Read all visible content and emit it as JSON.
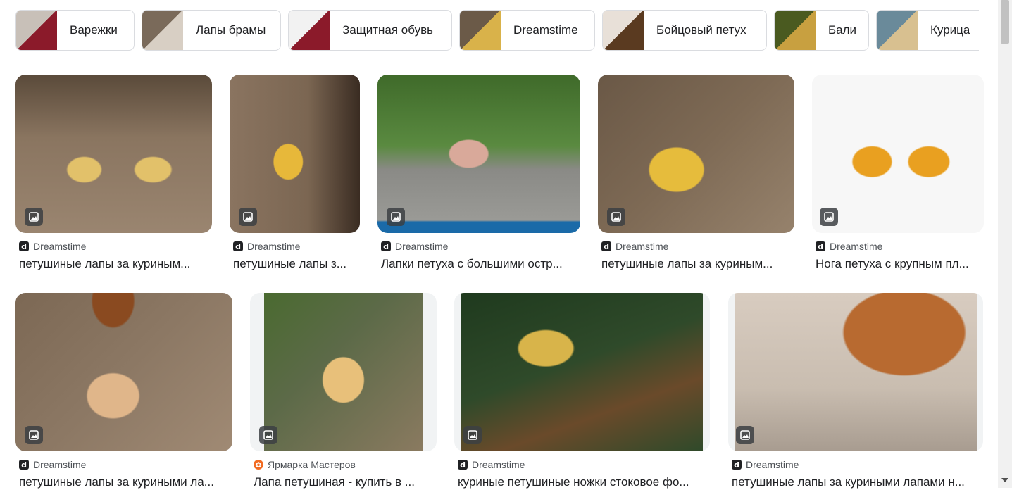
{
  "chips": [
    {
      "label": "Варежки",
      "thumb_colors": [
        "#c8c0b8",
        "#8b1a2a"
      ]
    },
    {
      "label": "Лапы брамы",
      "thumb_colors": [
        "#7a6a5a",
        "#d8cfc4"
      ]
    },
    {
      "label": "Защитная обувь",
      "thumb_colors": [
        "#f2f2f2",
        "#8b1a2a"
      ]
    },
    {
      "label": "Dreamstime",
      "thumb_colors": [
        "#6b5a48",
        "#d9b24a"
      ]
    },
    {
      "label": "Бойцовый петух",
      "thumb_colors": [
        "#e8e0d8",
        "#5a3a20"
      ]
    },
    {
      "label": "Бали",
      "thumb_colors": [
        "#4a5a20",
        "#c8a040"
      ]
    },
    {
      "label": "Курица",
      "thumb_colors": [
        "#6a8a9a",
        "#d8c090"
      ]
    }
  ],
  "results": [
    {
      "source": "Dreamstime",
      "title": "петушиные лапы за куриным...",
      "bg": "#8a7560",
      "accent": "#e2c16a",
      "icon": "dreamstime"
    },
    {
      "source": "Dreamstime",
      "title": "петушиные лапы з...",
      "bg": "#7b6652",
      "accent": "#e7b83a",
      "icon": "dreamstime"
    },
    {
      "source": "Dreamstime",
      "title": "Лапки петуха с большими остр...",
      "bg": "#4f7a3a",
      "accent": "#d9a99a",
      "icon": "dreamstime"
    },
    {
      "source": "Dreamstime",
      "title": "петушиные лапы за куриным...",
      "bg": "#7e6a55",
      "accent": "#e6bc3c",
      "icon": "dreamstime"
    },
    {
      "source": "Dreamstime",
      "title": "Нога петуха с крупным пл...",
      "bg": "#f7f7f7",
      "accent": "#e9a020",
      "icon": "dreamstime"
    },
    {
      "source": "Dreamstime",
      "title": "петушиные лапы за куриными ла...",
      "bg": "#8c7864",
      "accent": "#e0b68a",
      "icon": "dreamstime"
    },
    {
      "source": "Ярмарка Мастеров",
      "title": "Лапа петушиная - купить в ...",
      "bg": "#5c6a48",
      "accent": "#e8c07a",
      "icon": "yarmarka"
    },
    {
      "source": "Dreamstime",
      "title": "куриные петушиные ножки стоковое фо...",
      "bg": "#2f4a2a",
      "accent": "#d8b44a",
      "icon": "dreamstime"
    },
    {
      "source": "Dreamstime",
      "title": "петушиные лапы за куриными лапами н...",
      "bg": "#c9bdb0",
      "accent": "#b86a30",
      "icon": "dreamstime"
    }
  ]
}
